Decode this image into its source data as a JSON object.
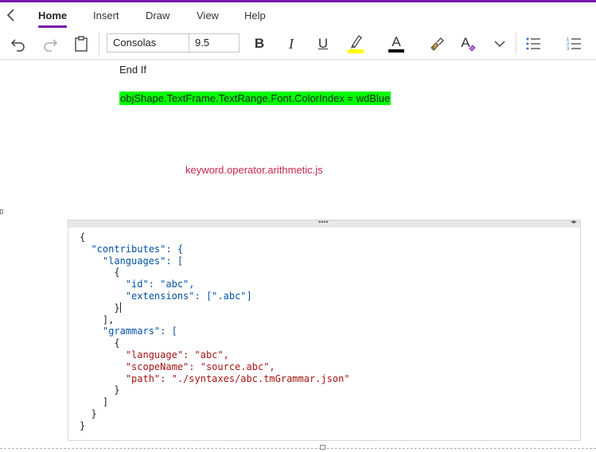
{
  "ribbon": {
    "tabs": [
      {
        "label": "Home",
        "active": true
      },
      {
        "label": "Insert",
        "active": false
      },
      {
        "label": "Draw",
        "active": false
      },
      {
        "label": "View",
        "active": false
      },
      {
        "label": "Help",
        "active": false
      }
    ],
    "accent_color": "#7719aa"
  },
  "toolbar": {
    "font_name": "Consolas",
    "font_size": "9.5",
    "bold_label": "B",
    "italic_label": "I",
    "underline_label": "U",
    "font_color_label": "A",
    "style_label": "A",
    "highlight_color": "#ffff00",
    "font_color": "#000000"
  },
  "page": {
    "end_if": "End If",
    "highlighted_line": "objShape.TextFrame.TextRange.Font.ColorIndex = wdBlue",
    "highlight_color": "#00ff00",
    "keyword_line": "keyword.operator.arithmetic.js",
    "keyword_color": "#c7254e"
  },
  "code_block": {
    "header_grip": "••••",
    "header_arrows": "◂▸",
    "lines": [
      "{",
      "  \"contributes\": {",
      "    \"languages\": [",
      "      {",
      "        \"id\": \"abc\",",
      "        \"extensions\": [\".abc\"]",
      "      }",
      "    ],",
      "    \"grammars\": [",
      "      {",
      "        \"language\": \"abc\",",
      "        \"scopeName\": \"source.abc\",",
      "        \"path\": \"./syntaxes/abc.tmGrammar.json\"",
      "      }",
      "    ]",
      "  }",
      "}"
    ]
  }
}
